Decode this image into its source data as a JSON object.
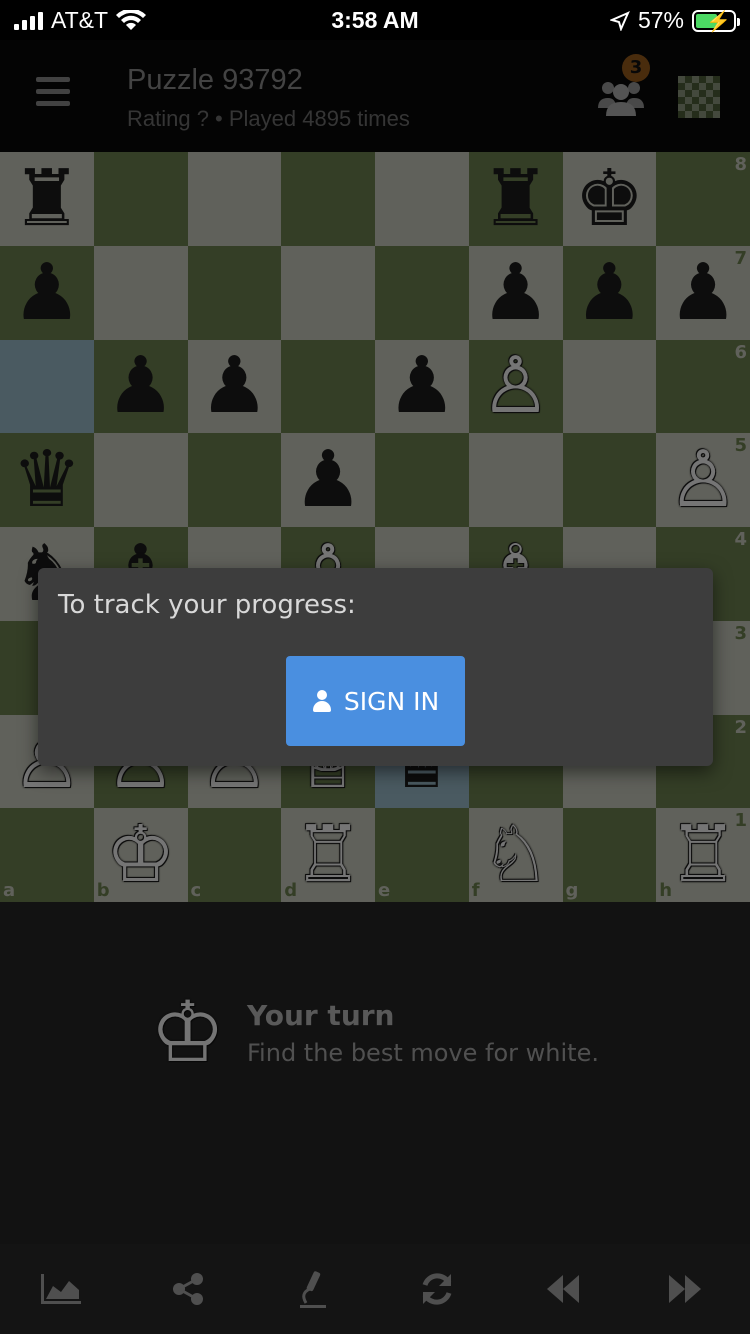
{
  "status_bar": {
    "carrier": "AT&T",
    "time": "3:58 AM",
    "battery": "57%"
  },
  "header": {
    "title": "Puzzle 93792",
    "subtitle": "Rating ? • Played 4895 times",
    "players_badge": "3",
    "icons": [
      "menu-icon",
      "people-icon",
      "board-icon"
    ]
  },
  "board": {
    "files": [
      "a",
      "b",
      "c",
      "d",
      "e",
      "f",
      "g",
      "h"
    ],
    "ranks": [
      "8",
      "7",
      "6",
      "5",
      "4",
      "3",
      "2",
      "1"
    ],
    "colors": {
      "light": "#c9cbbe",
      "dark": "#6e8250",
      "highlight": "#9cbcca"
    },
    "highlight_squares": [
      "a6",
      "e2"
    ],
    "pieces": [
      {
        "sq": "a8",
        "glyph": "♜",
        "side": "b"
      },
      {
        "sq": "f8",
        "glyph": "♜",
        "side": "b"
      },
      {
        "sq": "g8",
        "glyph": "♚",
        "side": "b"
      },
      {
        "sq": "a7",
        "glyph": "♟",
        "side": "b"
      },
      {
        "sq": "f7",
        "glyph": "♟",
        "side": "b"
      },
      {
        "sq": "g7",
        "glyph": "♟",
        "side": "b"
      },
      {
        "sq": "h7",
        "glyph": "♟",
        "side": "b"
      },
      {
        "sq": "b6",
        "glyph": "♟",
        "side": "b"
      },
      {
        "sq": "c6",
        "glyph": "♟",
        "side": "b"
      },
      {
        "sq": "e6",
        "glyph": "♟",
        "side": "b"
      },
      {
        "sq": "f6",
        "glyph": "♙",
        "side": "w"
      },
      {
        "sq": "a5",
        "glyph": "♛",
        "side": "b"
      },
      {
        "sq": "d5",
        "glyph": "♟",
        "side": "b"
      },
      {
        "sq": "h5",
        "glyph": "♙",
        "side": "w"
      },
      {
        "sq": "a4",
        "glyph": "♞",
        "side": "b"
      },
      {
        "sq": "b4",
        "glyph": "♝",
        "side": "b"
      },
      {
        "sq": "d4",
        "glyph": "♙",
        "side": "w"
      },
      {
        "sq": "f4",
        "glyph": "♗",
        "side": "w"
      },
      {
        "sq": "a2",
        "glyph": "♙",
        "side": "w"
      },
      {
        "sq": "b2",
        "glyph": "♙",
        "side": "w"
      },
      {
        "sq": "c2",
        "glyph": "♙",
        "side": "w"
      },
      {
        "sq": "d2",
        "glyph": "♕",
        "side": "w"
      },
      {
        "sq": "e2",
        "glyph": "♛",
        "side": "b"
      },
      {
        "sq": "b1",
        "glyph": "♔",
        "side": "w"
      },
      {
        "sq": "d1",
        "glyph": "♖",
        "side": "w"
      },
      {
        "sq": "f1",
        "glyph": "♘",
        "side": "w"
      },
      {
        "sq": "h1",
        "glyph": "♖",
        "side": "w"
      }
    ]
  },
  "dialog": {
    "message": "To track your progress:",
    "button_label": "SIGN IN"
  },
  "turn": {
    "title": "Your turn",
    "subtitle": "Find the best move for white."
  },
  "toolbar": {
    "icons": [
      "chart-icon",
      "share-icon",
      "analysis-icon",
      "refresh-icon",
      "rewind-icon",
      "fast-forward-icon"
    ]
  }
}
